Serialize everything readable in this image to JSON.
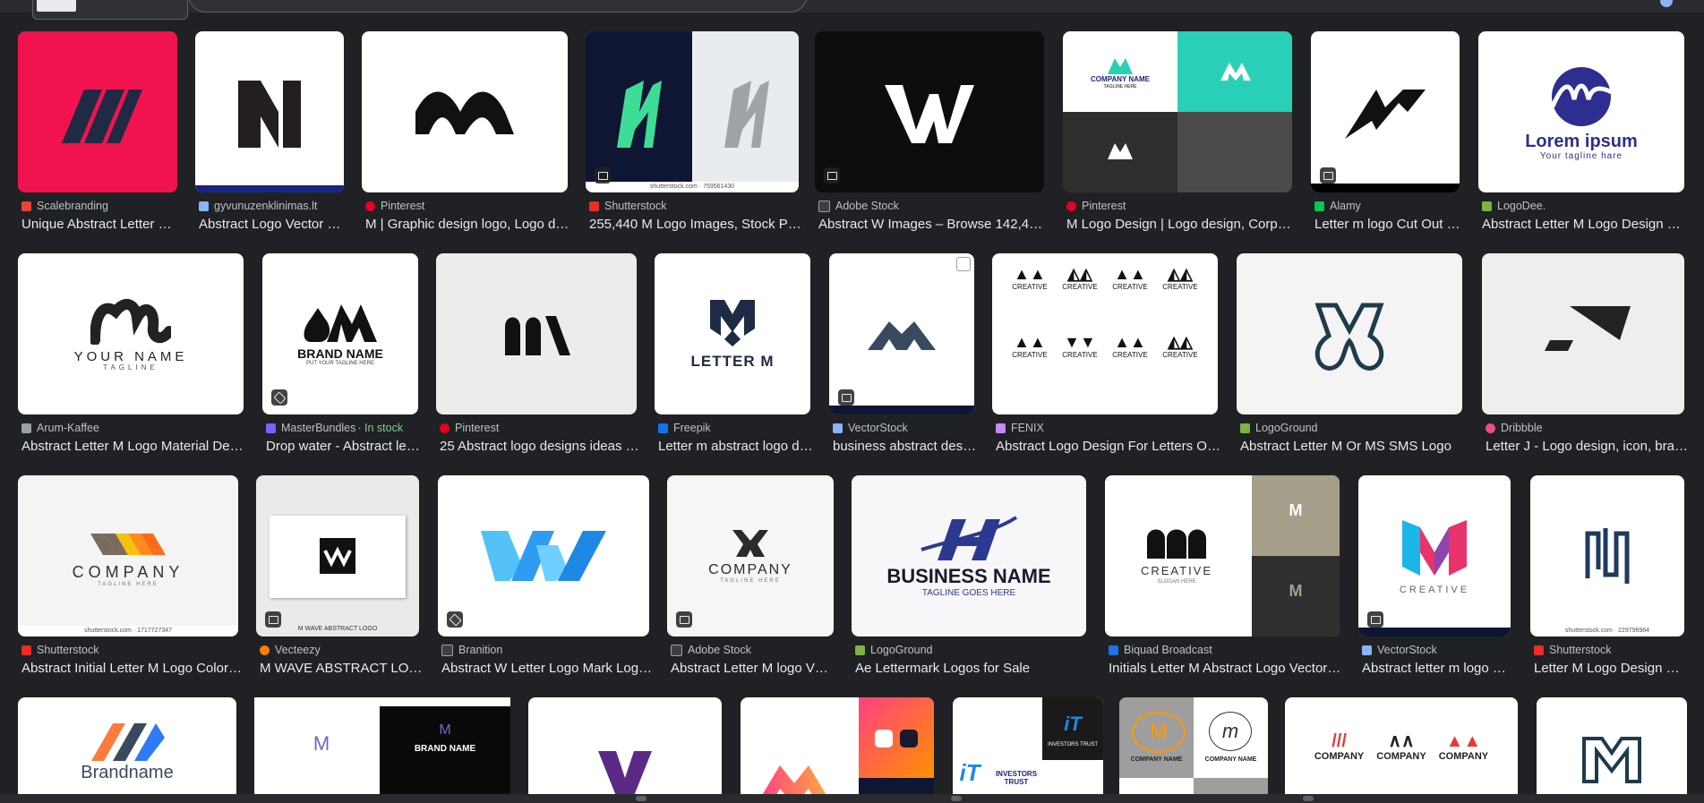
{
  "theme": {
    "bg": "#202124",
    "text": "#e8eaed",
    "muted": "#bdc1c6",
    "green": "#81c995"
  },
  "rows": [
    {
      "results": [
        {
          "source": "Scalebranding",
          "title": "Unique Abstract Letter …",
          "fav": "#ea4335"
        },
        {
          "source": "gyvunuzenklinimas.lt",
          "title": "Abstract Logo Vector …",
          "fav": "#8ab4f8"
        },
        {
          "source": "Pinterest",
          "title": "M | Graphic design logo, Logo d…",
          "fav": "#e60023"
        },
        {
          "source": "Shutterstock",
          "title": "255,440 M Logo Images, Stock P…",
          "fav": "#ee2b24"
        },
        {
          "source": "Adobe Stock",
          "title": "Abstract W Images – Browse 142,47…",
          "fav": "#5f6368"
        },
        {
          "source": "Pinterest",
          "title": "M Logo Design | Logo design, Corpo…",
          "fav": "#e60023"
        },
        {
          "source": "Alamy",
          "title": "Letter m logo Cut Out …",
          "fav": "#00c853"
        },
        {
          "source": "LogoDee.",
          "title": "Abstract Letter M Logo Design F…",
          "fav": "#7cb342"
        }
      ]
    },
    {
      "results": [
        {
          "source": "Arum-Kaffee",
          "title": "Abstract Letter M Logo Material Des…",
          "fav": "#9aa0a6"
        },
        {
          "source": "MasterBundles",
          "stock": "· In stock",
          "title": "Drop water - Abstract le…",
          "fav": "#7b61ff"
        },
        {
          "source": "Pinterest",
          "title": "25 Abstract logo designs ideas …",
          "fav": "#e60023"
        },
        {
          "source": "Freepik",
          "title": "Letter m abstract logo d…",
          "fav": "#1273eb"
        },
        {
          "source": "VectorStock",
          "title": "business abstract des…",
          "fav": "#8ab4f8"
        },
        {
          "source": "FENIX",
          "title": "Abstract Logo Design For Letters O…",
          "fav": "#c58af9"
        },
        {
          "source": "LogoGround",
          "title": "Abstract Letter M Or MS SMS Logo",
          "fav": "#7cb342"
        },
        {
          "source": "Dribbble",
          "title": "Letter J - Logo design, icon, bra…",
          "fav": "#ea4c89"
        }
      ]
    },
    {
      "results": [
        {
          "source": "Shutterstock",
          "title": "Abstract Initial Letter M Logo Color…",
          "fav": "#ee2b24"
        },
        {
          "source": "Vecteezy",
          "title": "M WAVE ABSTRACT LO…",
          "fav": "#ff7c00"
        },
        {
          "source": "Branition",
          "title": "Abstract W Letter Logo Mark Log…",
          "fav": "#5f6368"
        },
        {
          "source": "Adobe Stock",
          "title": "Abstract Letter M logo V…",
          "fav": "#5f6368"
        },
        {
          "source": "LogoGround",
          "title": "Ae Lettermark Logos for Sale",
          "fav": "#7cb342"
        },
        {
          "source": "Biquad Broadcast",
          "title": "Initials Letter M Abstract Logo Vector …",
          "fav": "#1a73e8"
        },
        {
          "source": "VectorStock",
          "title": "Abstract letter m logo …",
          "fav": "#8ab4f8"
        },
        {
          "source": "Shutterstock",
          "title": "Letter M Logo Design …",
          "fav": "#ee2b24"
        }
      ]
    }
  ],
  "thumb_text": {
    "company_name": "COMPANY NAME",
    "tagline_here": "TAGLINE HERE",
    "lorem": "Lorem ipsum",
    "lorem_tag": "Your tagline hare",
    "your_name": "YOUR NAME",
    "tagline": "TAGLINE",
    "brand_name": "BRAND NAME",
    "brand_tag": "PUT YOUR TAGLINE HERE",
    "letter_m": "LETTER M",
    "creative": "CREATIVE",
    "company": "COMPANY",
    "m_wave": "M WAVE ABSTRACT LOGO",
    "business_name": "BUSINESS NAME",
    "tagline_goes_here": "TAGLINE GOES HERE",
    "slogan_here": "SLOGAN HERE",
    "brandname": "Brandname",
    "investors": "INVESTORS TRUST",
    "shutter_id1": "shutterstock.com · 759561430",
    "shutter_id2": "shutterstock.com · 1717727347",
    "shutter_id3": "shutterstock.com · 229796984",
    "vectorstock": "VectorStock"
  }
}
